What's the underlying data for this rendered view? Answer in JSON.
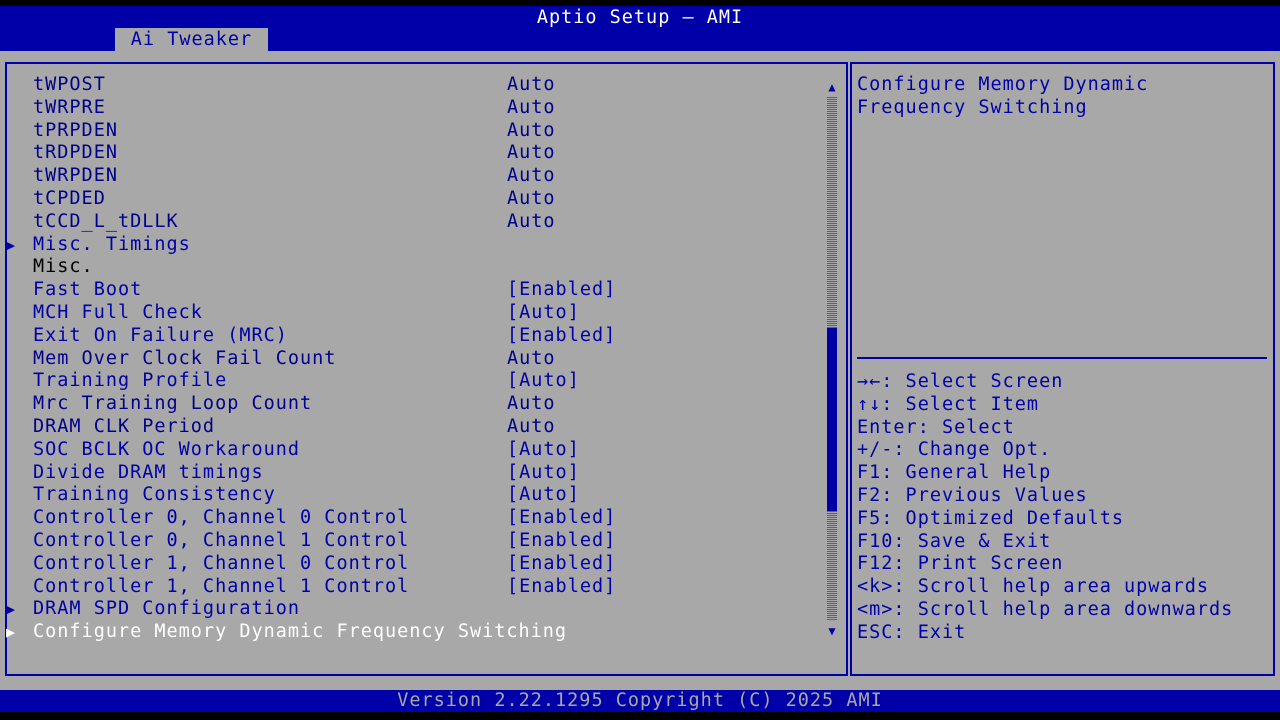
{
  "window": {
    "title": "Aptio Setup – AMI",
    "tab": "Ai Tweaker"
  },
  "items": [
    {
      "label": "tWPOST",
      "value": "Auto",
      "type": "readonly"
    },
    {
      "label": "tWRPRE",
      "value": "Auto",
      "type": "readonly"
    },
    {
      "label": "tPRPDEN",
      "value": "Auto",
      "type": "readonly"
    },
    {
      "label": "tRDPDEN",
      "value": "Auto",
      "type": "readonly"
    },
    {
      "label": "tWRPDEN",
      "value": "Auto",
      "type": "readonly"
    },
    {
      "label": "tCPDED",
      "value": "Auto",
      "type": "readonly"
    },
    {
      "label": "tCCD_L_tDLLK",
      "value": "Auto",
      "type": "readonly"
    },
    {
      "label": "Misc. Timings",
      "value": "",
      "type": "submenu"
    },
    {
      "label": "Misc.",
      "value": "",
      "type": "plain"
    },
    {
      "label": "Fast Boot",
      "value": "[Enabled]",
      "type": "option"
    },
    {
      "label": "MCH Full Check",
      "value": "[Auto]",
      "type": "option"
    },
    {
      "label": "Exit On Failure (MRC)",
      "value": "[Enabled]",
      "type": "option"
    },
    {
      "label": "Mem Over Clock Fail Count",
      "value": "Auto",
      "type": "readonly"
    },
    {
      "label": "Training Profile",
      "value": "[Auto]",
      "type": "option"
    },
    {
      "label": "Mrc Training Loop Count",
      "value": "Auto",
      "type": "readonly"
    },
    {
      "label": "DRAM CLK Period",
      "value": "Auto",
      "type": "readonly"
    },
    {
      "label": "SOC BCLK OC Workaround",
      "value": "[Auto]",
      "type": "option"
    },
    {
      "label": "Divide DRAM timings",
      "value": "[Auto]",
      "type": "option"
    },
    {
      "label": "Training Consistency",
      "value": "[Auto]",
      "type": "option"
    },
    {
      "label": "Controller 0, Channel 0 Control",
      "value": "[Enabled]",
      "type": "option"
    },
    {
      "label": "Controller 0, Channel 1 Control",
      "value": "[Enabled]",
      "type": "option"
    },
    {
      "label": "Controller 1, Channel 0 Control",
      "value": "[Enabled]",
      "type": "option"
    },
    {
      "label": "Controller 1, Channel 1 Control",
      "value": "[Enabled]",
      "type": "option"
    },
    {
      "label": "DRAM SPD Configuration",
      "value": "",
      "type": "submenu"
    },
    {
      "label": "Configure Memory Dynamic Frequency Switching",
      "value": "",
      "type": "submenu-selected"
    }
  ],
  "scrollbar": {
    "up_arrow": "▲",
    "down_arrow": "▼",
    "position_fraction": 0.68,
    "visible_fraction": 0.35
  },
  "help": {
    "description": [
      "Configure Memory Dynamic",
      "Frequency Switching"
    ],
    "keys": [
      "→←: Select Screen",
      "↑↓: Select Item",
      "Enter: Select",
      "+/-: Change Opt.",
      "F1: General Help",
      "F2: Previous Values",
      "F5: Optimized Defaults",
      "F10: Save & Exit",
      "F12: Print Screen",
      "<k>: Scroll help area upwards",
      "<m>: Scroll help area downwards",
      "ESC: Exit"
    ]
  },
  "footer": "Version 2.22.1295 Copyright (C) 2025 AMI",
  "colors": {
    "background": "#a8a8a8",
    "accent": "#0000a8",
    "selected_text": "#ffffff"
  }
}
